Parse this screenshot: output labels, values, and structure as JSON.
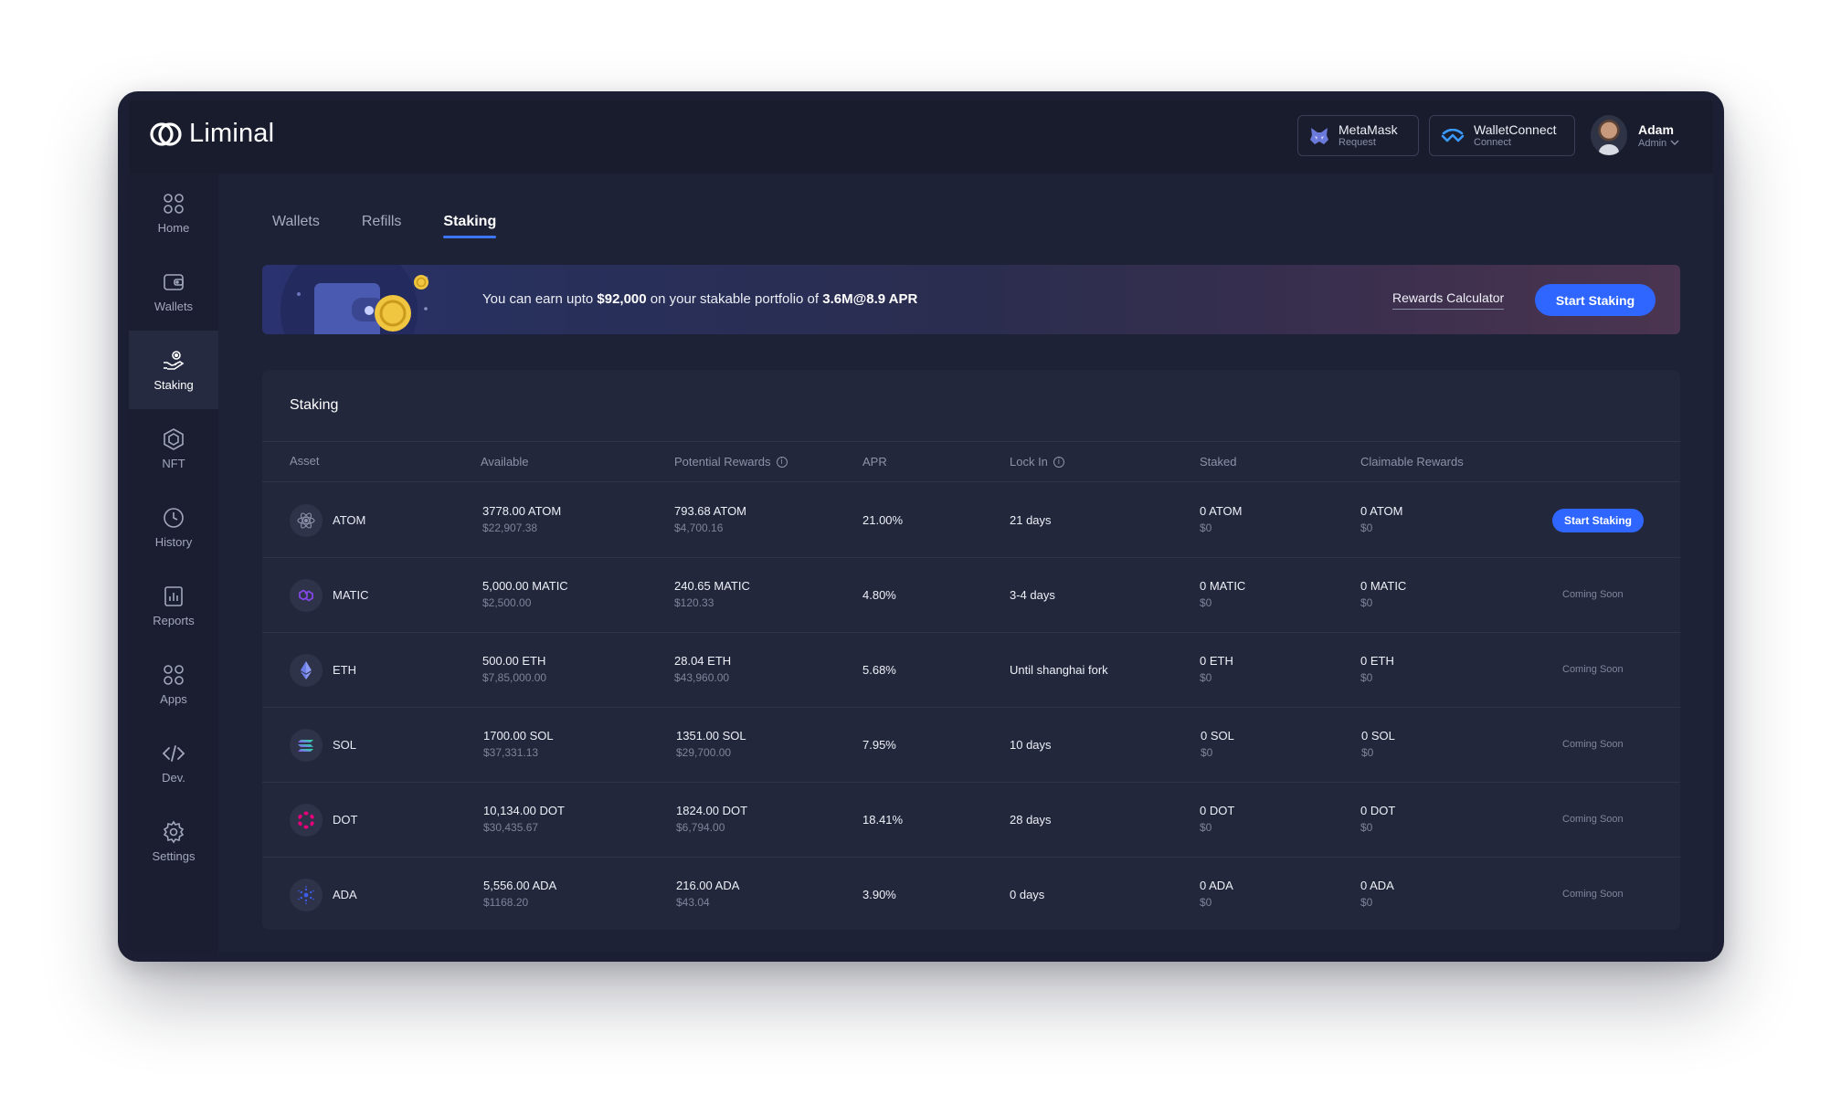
{
  "app": {
    "name": "Liminal"
  },
  "header": {
    "metamask": {
      "title": "MetaMask",
      "subtitle": "Request"
    },
    "walletconnect": {
      "title": "WalletConnect",
      "subtitle": "Connect"
    },
    "user": {
      "name": "Adam",
      "role": "Admin"
    }
  },
  "sidebar": {
    "items": [
      {
        "label": "Home",
        "icon": "home-grid-icon"
      },
      {
        "label": "Wallets",
        "icon": "wallet-icon"
      },
      {
        "label": "Staking",
        "icon": "staking-hand-icon",
        "active": true
      },
      {
        "label": "NFT",
        "icon": "nft-hexagon-icon"
      },
      {
        "label": "History",
        "icon": "clock-icon"
      },
      {
        "label": "Reports",
        "icon": "bar-chart-icon"
      },
      {
        "label": "Apps",
        "icon": "apps-grid-icon"
      },
      {
        "label": "Dev.",
        "icon": "code-icon"
      },
      {
        "label": "Settings",
        "icon": "gear-icon"
      }
    ]
  },
  "tabs": [
    {
      "label": "Wallets"
    },
    {
      "label": "Refills"
    },
    {
      "label": "Staking",
      "active": true
    }
  ],
  "banner": {
    "text_prefix": "You can earn upto ",
    "amount": "$92,000",
    "text_middle": " on your stakable portfolio of ",
    "portfolio": "3.6M@8.9 APR",
    "rewards_calculator": "Rewards Calculator",
    "start_staking": "Start Staking"
  },
  "staking": {
    "title": "Staking",
    "columns": [
      "Asset",
      "Available",
      "Potential Rewards",
      "APR",
      "Lock In",
      "Staked",
      "Claimable Rewards"
    ],
    "rows": [
      {
        "asset": "ATOM",
        "available": "3778.00 ATOM",
        "available_usd": "$22,907.38",
        "rewards": "793.68 ATOM",
        "rewards_usd": "$4,700.16",
        "apr": "21.00%",
        "lock_in": "21 days",
        "staked": "0 ATOM",
        "staked_usd": "$0",
        "claimable": "0 ATOM",
        "claimable_usd": "$0",
        "action": "Start Staking"
      },
      {
        "asset": "MATIC",
        "available": "5,000.00 MATIC",
        "available_usd": "$2,500.00",
        "rewards": "240.65 MATIC",
        "rewards_usd": "$120.33",
        "apr": "4.80%",
        "lock_in": "3-4 days",
        "staked": "0 MATIC",
        "staked_usd": "$0",
        "claimable": "0 MATIC",
        "claimable_usd": "$0",
        "action": "Coming Soon"
      },
      {
        "asset": "ETH",
        "available": "500.00 ETH",
        "available_usd": "$7,85,000.00",
        "rewards": "28.04 ETH",
        "rewards_usd": "$43,960.00",
        "apr": "5.68%",
        "lock_in": "Until shanghai fork",
        "staked": "0 ETH",
        "staked_usd": "$0",
        "claimable": "0 ETH",
        "claimable_usd": "$0",
        "action": "Coming Soon"
      },
      {
        "asset": "SOL",
        "available": "1700.00 SOL",
        "available_usd": "$37,331.13",
        "rewards": "1351.00 SOL",
        "rewards_usd": "$29,700.00",
        "apr": "7.95%",
        "lock_in": "10 days",
        "staked": "0 SOL",
        "staked_usd": "$0",
        "claimable": "0 SOL",
        "claimable_usd": "$0",
        "action": "Coming Soon"
      },
      {
        "asset": "DOT",
        "available": "10,134.00 DOT",
        "available_usd": "$30,435.67",
        "rewards": "1824.00 DOT",
        "rewards_usd": "$6,794.00",
        "apr": "18.41%",
        "lock_in": "28 days",
        "staked": "0 DOT",
        "staked_usd": "$0",
        "claimable": "0 DOT",
        "claimable_usd": "$0",
        "action": "Coming Soon"
      },
      {
        "asset": "ADA",
        "available": "5,556.00 ADA",
        "available_usd": "$1168.20",
        "rewards": "216.00 ADA",
        "rewards_usd": "$43.04",
        "apr": "3.90%",
        "lock_in": "0 days",
        "staked": "0 ADA",
        "staked_usd": "$0",
        "claimable": "0 ADA",
        "claimable_usd": "$0",
        "action": "Coming Soon"
      }
    ]
  },
  "colors": {
    "accent": "#2e66ff",
    "background": "#1e2236",
    "card": "#23273c"
  }
}
